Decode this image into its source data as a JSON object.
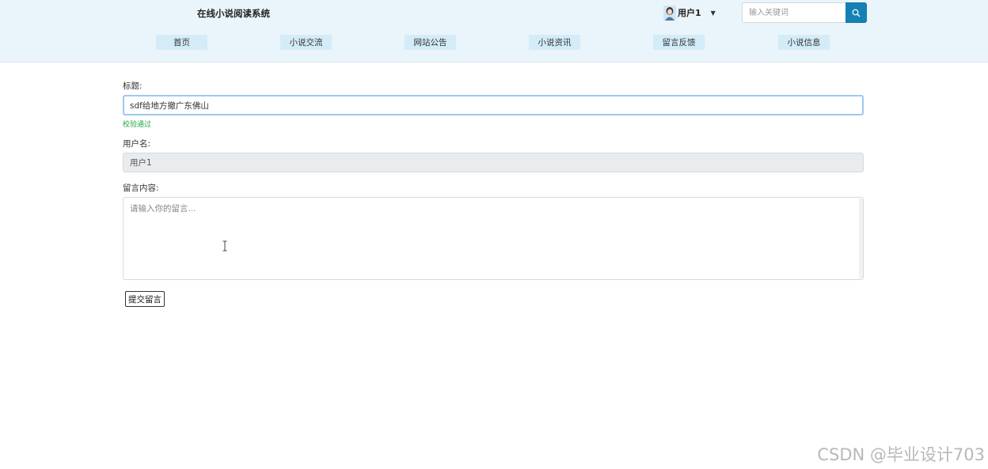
{
  "header": {
    "site_title": "在线小说阅读系统",
    "user_name": "用户1",
    "search_placeholder": "输入关键词",
    "brand_color": "#eaf4fb",
    "accent_color": "#1580b4"
  },
  "nav": {
    "items": [
      {
        "label": "首页"
      },
      {
        "label": "小说交流"
      },
      {
        "label": "网站公告"
      },
      {
        "label": "小说资讯"
      },
      {
        "label": "留言反馈"
      },
      {
        "label": "小说信息"
      }
    ],
    "item_bg_color": "#d3ecf8"
  },
  "form": {
    "title_label": "标题:",
    "title_value": "sdf给地方撤广东佛山",
    "title_valid_msg": "校验通过",
    "username_label": "用户名:",
    "username_value": "用户1",
    "content_label": "留言内容:",
    "content_placeholder": "请输入你的留言...",
    "submit_label": "提交留言",
    "valid_color": "#28a745"
  },
  "watermark": "CSDN @毕业设计703",
  "icons": [
    "avatar-icon",
    "caret-down-icon",
    "search-icon",
    "text-cursor-icon"
  ]
}
